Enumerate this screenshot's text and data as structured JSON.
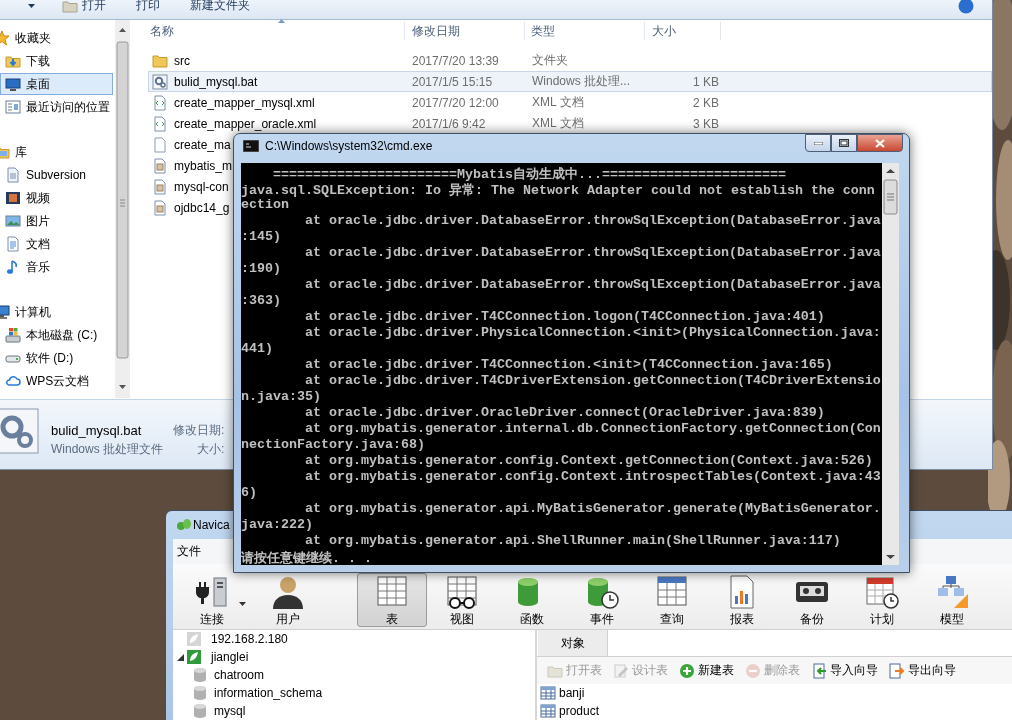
{
  "explorer": {
    "toolbar": [
      {
        "label": "打开",
        "kind": "open"
      },
      {
        "label": "打印",
        "kind": "print"
      },
      {
        "label": "新建文件夹",
        "kind": "newfolder"
      }
    ],
    "nav": [
      {
        "label": "收藏夹",
        "kind": "star",
        "selected": false,
        "children": [
          {
            "label": "下载",
            "kind": "download",
            "selected": false
          },
          {
            "label": "桌面",
            "kind": "desktop",
            "selected": true
          },
          {
            "label": "最近访问的位置",
            "kind": "recent",
            "selected": false
          }
        ]
      },
      {
        "label": "库",
        "kind": "library",
        "selected": false,
        "children": [
          {
            "label": "Subversion",
            "kind": "svn",
            "selected": false
          },
          {
            "label": "视频",
            "kind": "video",
            "selected": false
          },
          {
            "label": "图片",
            "kind": "pictures",
            "selected": false
          },
          {
            "label": "文档",
            "kind": "docs",
            "selected": false
          },
          {
            "label": "音乐",
            "kind": "music",
            "selected": false
          }
        ]
      },
      {
        "label": "计算机",
        "kind": "computer",
        "selected": false,
        "children": [
          {
            "label": "本地磁盘 (C:)",
            "kind": "disk",
            "selected": false
          },
          {
            "label": "软件 (D:)",
            "kind": "drive",
            "selected": false
          },
          {
            "label": "WPS云文档",
            "kind": "cloud",
            "selected": false
          }
        ]
      }
    ],
    "columns": [
      "名称",
      "修改日期",
      "类型",
      "大小"
    ],
    "files": [
      {
        "name": "src",
        "date": "2017/7/20 13:39",
        "type": "文件夹",
        "kind": "folder",
        "selected": false
      },
      {
        "name": "bulid_mysql.bat",
        "date": "2017/1/5 15:15",
        "type": "Windows 批处理...",
        "size": "1 KB",
        "kind": "bat",
        "selected": true
      },
      {
        "name": "create_mapper_mysql.xml",
        "date": "2017/7/20 12:00",
        "type": "XML 文档",
        "size": "2 KB",
        "kind": "xml",
        "selected": false
      },
      {
        "name": "create_mapper_oracle.xml",
        "date": "2017/1/6 9:42",
        "type": "XML 文档",
        "size": "3 KB",
        "kind": "xml",
        "selected": false
      },
      {
        "name": "create_ma",
        "kind": "file",
        "selected": false
      },
      {
        "name": "mybatis_m",
        "kind": "jar",
        "selected": false
      },
      {
        "name": "mysql-con",
        "kind": "jar",
        "selected": false
      },
      {
        "name": "ojdbc14_g",
        "kind": "jar",
        "selected": false
      }
    ],
    "details": {
      "name": "bulid_mysql.bat",
      "type": "Windows 批处理文件",
      "labels": [
        "修改日期:",
        "大小:"
      ]
    }
  },
  "cmd": {
    "title": "C:\\Windows\\system32\\cmd.exe",
    "lines": [
      "    =======================Mybatis自动生成中...=======================",
      "java.sql.SQLException: Io 异常: The Network Adapter could not establish the conn",
      "ection",
      "        at oracle.jdbc.driver.DatabaseError.throwSqlException(DatabaseError.java",
      ":145)",
      "        at oracle.jdbc.driver.DatabaseError.throwSqlException(DatabaseError.java",
      ":190)",
      "        at oracle.jdbc.driver.DatabaseError.throwSqlException(DatabaseError.java",
      ":363)",
      "        at oracle.jdbc.driver.T4CConnection.logon(T4CConnection.java:401)",
      "        at oracle.jdbc.driver.PhysicalConnection.<init>(PhysicalConnection.java:",
      "441)",
      "        at oracle.jdbc.driver.T4CConnection.<init>(T4CConnection.java:165)",
      "        at oracle.jdbc.driver.T4CDriverExtension.getConnection(T4CDriverExtensio",
      "n.java:35)",
      "        at oracle.jdbc.driver.OracleDriver.connect(OracleDriver.java:839)",
      "        at org.mybatis.generator.internal.db.ConnectionFactory.getConnection(Con",
      "nectionFactory.java:68)",
      "        at org.mybatis.generator.config.Context.getConnection(Context.java:526)",
      "        at org.mybatis.generator.config.Context.introspectTables(Context.java:43",
      "6)",
      "        at org.mybatis.generator.api.MyBatisGenerator.generate(MyBatisGenerator.",
      "java:222)",
      "        at org.mybatis.generator.api.ShellRunner.main(ShellRunner.java:117)",
      "请按任意键继续. . ."
    ]
  },
  "navicat": {
    "title": "Navica",
    "menu": [
      "文件"
    ],
    "tools": [
      {
        "label": "连接",
        "kind": "connect",
        "selected": false,
        "dropdown": true
      },
      {
        "label": "用户",
        "kind": "user",
        "selected": false,
        "dropdown": false
      },
      {
        "label": "表",
        "kind": "table",
        "selected": true,
        "dropdown": false
      },
      {
        "label": "视图",
        "kind": "view",
        "selected": false,
        "dropdown": false
      },
      {
        "label": "函数",
        "kind": "function",
        "selected": false,
        "dropdown": false
      },
      {
        "label": "事件",
        "kind": "event",
        "selected": false,
        "dropdown": false
      },
      {
        "label": "查询",
        "kind": "query",
        "selected": false,
        "dropdown": false
      },
      {
        "label": "报表",
        "kind": "report",
        "selected": false,
        "dropdown": false
      },
      {
        "label": "备份",
        "kind": "backup",
        "selected": false,
        "dropdown": false
      },
      {
        "label": "计划",
        "kind": "schedule",
        "selected": false,
        "dropdown": false
      },
      {
        "label": "模型",
        "kind": "model",
        "selected": false,
        "dropdown": false
      }
    ],
    "tree": [
      {
        "label": "192.168.2.180",
        "connected": false,
        "expanded": false
      },
      {
        "label": "jianglei",
        "connected": true,
        "expanded": true,
        "children": [
          {
            "label": "chatroom"
          },
          {
            "label": "information_schema"
          },
          {
            "label": "mysql"
          }
        ]
      }
    ],
    "tabs": [
      {
        "label": "对象",
        "selected": true
      }
    ],
    "actions": [
      {
        "label": "打开表",
        "kind": "open",
        "disabled": true
      },
      {
        "label": "设计表",
        "kind": "design",
        "disabled": true
      },
      {
        "label": "新建表",
        "kind": "new",
        "disabled": false
      },
      {
        "label": "删除表",
        "kind": "delete",
        "disabled": true
      },
      {
        "label": "导入向导",
        "kind": "import",
        "disabled": false
      },
      {
        "label": "导出向导",
        "kind": "export",
        "disabled": false
      }
    ],
    "tables": [
      "banji",
      "product"
    ]
  }
}
